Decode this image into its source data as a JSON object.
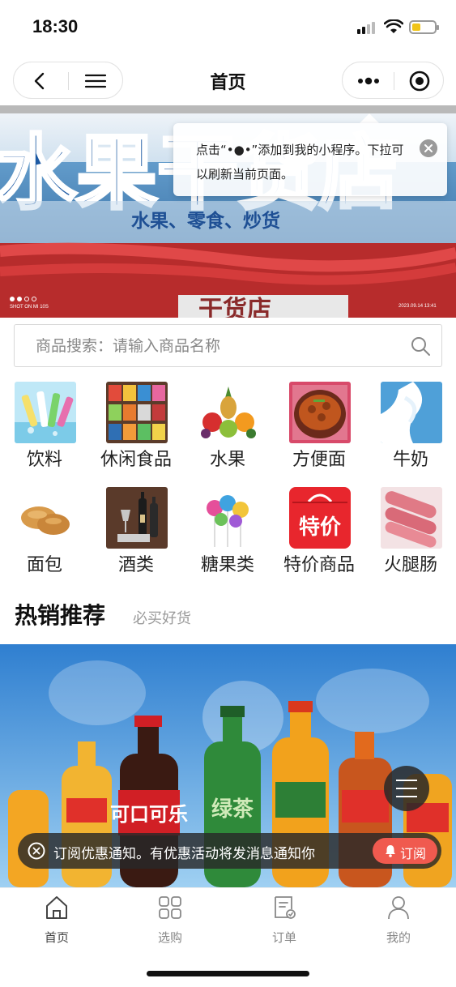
{
  "status_bar": {
    "time": "18:30"
  },
  "nav": {
    "title": "首页"
  },
  "banner": {
    "watermark": "SHOT ON MI 10S",
    "photo_date": "2023.09.14 13:41",
    "active_index": 1,
    "sign_text": "水果干货店",
    "sign_sub": "水果、零食、炒货",
    "sign_bottom": "干货店"
  },
  "tooltip": {
    "text": "点击“•●•”添加到我的小程序。下拉可以刷新当前页面。"
  },
  "search": {
    "placeholder": "商品搜索：请输入商品名称"
  },
  "categories": [
    {
      "label": "饮料",
      "icon": "drinks-thumb"
    },
    {
      "label": "休闲食品",
      "icon": "snacks-thumb"
    },
    {
      "label": "水果",
      "icon": "fruit-thumb"
    },
    {
      "label": "方便面",
      "icon": "noodles-thumb"
    },
    {
      "label": "牛奶",
      "icon": "milk-thumb"
    },
    {
      "label": "面包",
      "icon": "bread-thumb"
    },
    {
      "label": "酒类",
      "icon": "wine-thumb"
    },
    {
      "label": "糖果类",
      "icon": "candy-thumb"
    },
    {
      "label": "特价商品",
      "icon": "special-offer-thumb",
      "badge": "特价"
    },
    {
      "label": "火腿肠",
      "icon": "sausage-thumb"
    }
  ],
  "hot": {
    "title": "热销推荐",
    "subtitle": "必买好货"
  },
  "product_image": {
    "bottle_labels": [
      "可口可乐",
      "绿茶"
    ]
  },
  "subscribe": {
    "text": "订阅优惠通知。有优惠活动将发消息通知你",
    "button": "订阅"
  },
  "tabs": [
    {
      "label": "首页",
      "icon": "home-icon",
      "active": true
    },
    {
      "label": "选购",
      "icon": "grid-icon",
      "active": false
    },
    {
      "label": "订单",
      "icon": "order-icon",
      "active": false
    },
    {
      "label": "我的",
      "icon": "user-icon",
      "active": false
    }
  ],
  "colors": {
    "accent": "#f05a4f",
    "text": "#222222",
    "muted": "#888888"
  }
}
